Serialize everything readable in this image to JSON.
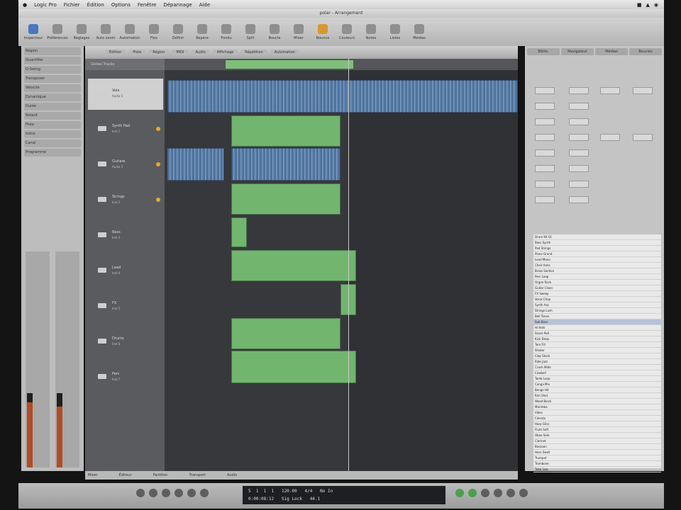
{
  "app": {
    "menu": [
      "Logic Pro",
      "Fichier",
      "Édition",
      "Options",
      "Fenêtre",
      "Dépannage",
      "Aide"
    ],
    "window_title": "polar - Arrangement"
  },
  "toolbar": {
    "buttons": [
      "Inspecteur",
      "Préférences",
      "Réglages",
      "Auto zoom",
      "Automation",
      "Flex",
      "Définir",
      "Repère",
      "Fondu",
      "Split",
      "Boucle",
      "Mixer",
      "Bounce",
      "Couleurs",
      "Notes",
      "Listes",
      "Médias"
    ]
  },
  "inspector": {
    "rows": [
      "Région",
      "Quantifier",
      "Q-Swing",
      "Transposer",
      "Vélocité",
      "Dynamique",
      "Durée",
      "Retard",
      "Piste",
      "Icône",
      "Canal",
      "Programme"
    ]
  },
  "arrange": {
    "tabs": [
      "Édition",
      "Piste",
      "Région",
      "MIDI",
      "Audio",
      "Affichage",
      "Répétition",
      "Automation"
    ],
    "track_header": "Global Tracks"
  },
  "tracks": [
    {
      "name": "Voix",
      "sub": "Audio 1"
    },
    {
      "name": "Synth Pad",
      "sub": "Inst 1"
    },
    {
      "name": "Guitare",
      "sub": "Audio 2"
    },
    {
      "name": "Strings",
      "sub": "Inst 2"
    },
    {
      "name": "Bass",
      "sub": "Inst 3"
    },
    {
      "name": "Lead",
      "sub": "Inst 4"
    },
    {
      "name": "FX",
      "sub": "Inst 5"
    },
    {
      "name": "Drums",
      "sub": "Inst 6"
    },
    {
      "name": "Perc",
      "sub": "Inst 7"
    }
  ],
  "right_panel": {
    "tabs": [
      "Biblio.",
      "Navigateur",
      "Médias",
      "Boucles"
    ],
    "list_rows": [
      "Drum Kit 01",
      "Bass Synth",
      "Pad Strings",
      "Piano Grand",
      "Lead Mono",
      "Choir Aahs",
      "Brass Section",
      "Perc Loop",
      "Organ Rock",
      "Guitar Clean",
      "FX Sweep",
      "Vocal Chop",
      "Synth Arp",
      "Strings Lush",
      "Bell Tones",
      "Sub Bass",
      "Hi Hats",
      "Snare Roll",
      "Kick Deep",
      "Tom Fill",
      "Shaker",
      "Clap Stack",
      "Ride Jazz",
      "Crash Wide",
      "Cowbell",
      "Tamb Loop",
      "Conga Mix",
      "Bongo Hit",
      "Rim Shot",
      "Wood Block",
      "Marimba",
      "Vibes",
      "Celesta",
      "Harp Gliss",
      "Flute Soft",
      "Oboe Solo",
      "Clarinet",
      "Bassoon",
      "Horn Swell",
      "Trumpet",
      "Trombone",
      "Tuba Low"
    ]
  },
  "bottom": {
    "labels": [
      "Mixer",
      "Éditeur",
      "Partition",
      "Transport",
      "Audio"
    ]
  },
  "transport": {
    "lcd_line1": "5  1  1  1   120.00   4/4   No In",
    "lcd_line2": "0:00:08:12   Sig Lock   44.1"
  }
}
